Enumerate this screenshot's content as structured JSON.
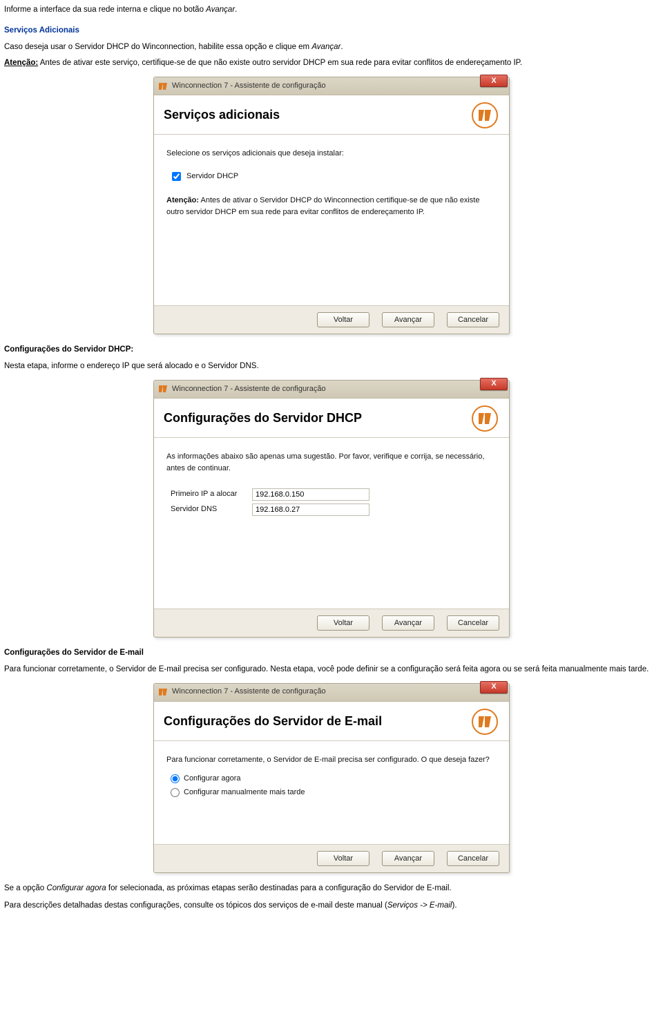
{
  "doc": {
    "p1_a": "Informe a interface da sua rede interna e clique no botão ",
    "p1_b": "Avançar",
    "p1_c": ".",
    "h_servicos": "Serviços Adicionais",
    "p2_a": "Caso deseja usar o Servidor DHCP do Winconnection, habilite essa opção e clique em ",
    "p2_b": "Avançar",
    "p2_c": ".",
    "p3_a": "Atenção:",
    "p3_b": " Antes de ativar este serviço, certifique-se de que não existe outro servidor DHCP em sua rede para evitar conflitos de endereçamento IP.",
    "h_conf_dhcp": "Configurações do Servidor DHCP:",
    "p4": "Nesta etapa, informe o endereço IP que será alocado e o Servidor DNS.",
    "h_conf_email": "Configurações do Servidor de E-mail",
    "p5": "Para funcionar corretamente, o Servidor de E-mail precisa ser configurado. Nesta etapa, você pode definir se a configuração será feita agora ou se será feita manualmente mais tarde.",
    "p6_a": "Se a opção ",
    "p6_b": "Configurar agora",
    "p6_c": " for selecionada, as próximas etapas serão destinadas para a configuração do Servidor de E-mail.",
    "p7_a": "Para descrições detalhadas destas configurações, consulte os tópicos dos serviços de e-mail deste manual (",
    "p7_b": "Serviços -> E-mail",
    "p7_c": ")."
  },
  "dlg_common": {
    "title": "Winconnection 7 - Assistente de configuração",
    "btn_back": "Voltar",
    "btn_next": "Avançar",
    "btn_cancel": "Cancelar",
    "close_glyph": "X"
  },
  "dlg1": {
    "heading": "Serviços adicionais",
    "intro": "Selecione os serviços adicionais que deseja instalar:",
    "cb_label": "Servidor DHCP",
    "warn_bold": "Atenção:",
    "warn_text": " Antes de ativar o Servidor DHCP do Winconnection certifique-se de que não existe outro servidor DHCP em sua rede para evitar conflitos de endereçamento IP."
  },
  "dlg2": {
    "heading": "Configurações do Servidor DHCP",
    "intro": "As informações abaixo são apenas uma sugestão. Por favor, verifique e corrija, se necessário, antes de continuar.",
    "lbl_ip": "Primeiro IP a alocar",
    "val_ip": "192.168.0.150",
    "lbl_dns": "Servidor DNS",
    "val_dns": "192.168.0.27"
  },
  "dlg3": {
    "heading": "Configurações do Servidor de E-mail",
    "intro": "Para funcionar corretamente, o Servidor de E-mail precisa ser configurado. O que deseja fazer?",
    "opt1": "Configurar agora",
    "opt2": "Configurar manualmente mais tarde"
  }
}
